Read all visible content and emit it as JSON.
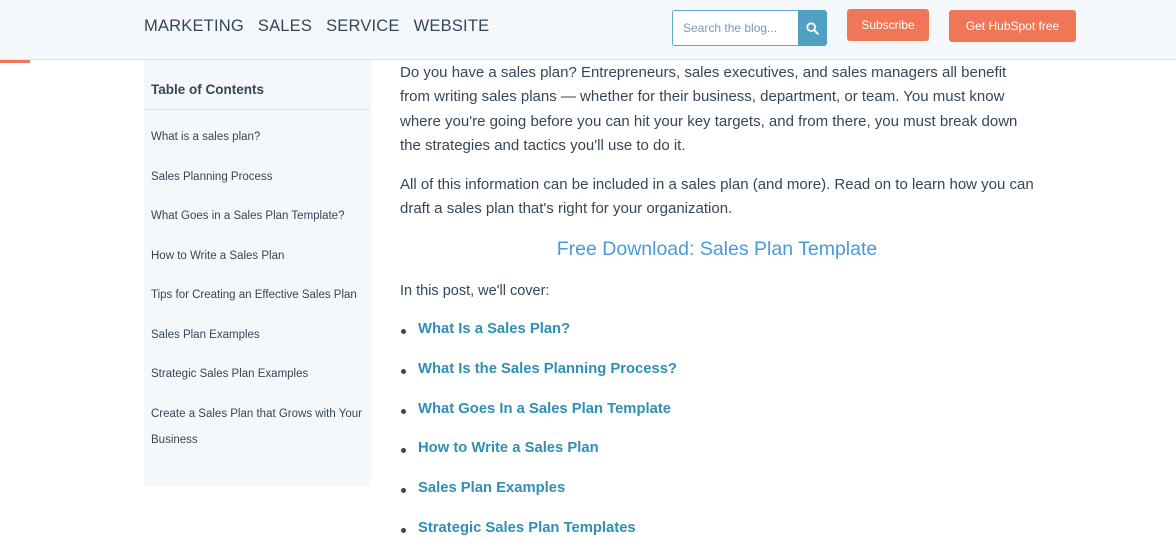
{
  "header": {
    "nav": [
      "MARKETING",
      "SALES",
      "SERVICE",
      "WEBSITE"
    ],
    "search_placeholder": "Search the blog...",
    "subscribe_label": "Subscribe",
    "get_free_label": "Get HubSpot free"
  },
  "toc": {
    "title": "Table of Contents",
    "items": [
      "What is a sales plan?",
      "Sales Planning Process",
      "What Goes in a Sales Plan Template?",
      "How to Write a Sales Plan",
      "Tips for Creating an Effective Sales Plan",
      "Sales Plan Examples",
      "Strategic Sales Plan Examples",
      "Create a Sales Plan that Grows with Your Business"
    ]
  },
  "article": {
    "paragraph1": "Do you have a sales plan? Entrepreneurs, sales executives, and sales managers all benefit from writing sales plans — whether for their business, department, or team. You must know where you're going before you can hit your key targets, and from there, you must break down the strategies and tactics you'll use to do it.",
    "paragraph2": "All of this information can be included in a sales plan (and more). Read on to learn how you can draft a sales plan that's right for your organization.",
    "cta": "Free Download: Sales Plan Template",
    "intro": "In this post, we'll cover:",
    "links": [
      "What Is a Sales Plan?",
      "What Is the Sales Planning Process?",
      "What Goes In a Sales Plan Template",
      "How to Write a Sales Plan",
      "Sales Plan Examples",
      "Strategic Sales Plan Templates"
    ]
  },
  "colors": {
    "accent": "#ef7656",
    "link": "#2f8fb4",
    "cta": "#4a9ad8",
    "text": "#33475b"
  },
  "icons": {
    "search": "search-icon"
  }
}
